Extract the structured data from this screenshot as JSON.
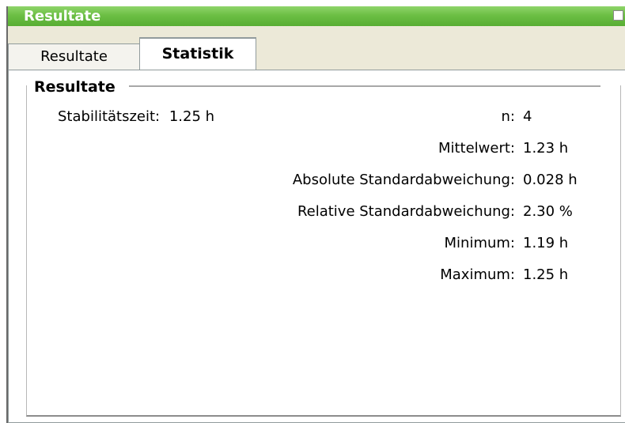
{
  "window": {
    "title": "Resultate"
  },
  "tabs": [
    {
      "label": "Resultate",
      "selected": false
    },
    {
      "label": "Statistik",
      "selected": true
    }
  ],
  "group": {
    "title": "Resultate"
  },
  "stability": {
    "label": "Stabilitätszeit:",
    "value": "1.25 h"
  },
  "stats": [
    {
      "label": "n:",
      "value": "4"
    },
    {
      "label": "Mittelwert:",
      "value": "1.23 h"
    },
    {
      "label": "Absolute Standardabweichung:",
      "value": "0.028 h"
    },
    {
      "label": "Relative Standardabweichung:",
      "value": "2.30 %"
    },
    {
      "label": "Minimum:",
      "value": "1.19 h"
    },
    {
      "label": "Maximum:",
      "value": "1.25 h"
    }
  ],
  "colors": {
    "titlebar": "#6cbf44",
    "tab_border": "#919b9c",
    "window_bg": "#ece9d8"
  }
}
